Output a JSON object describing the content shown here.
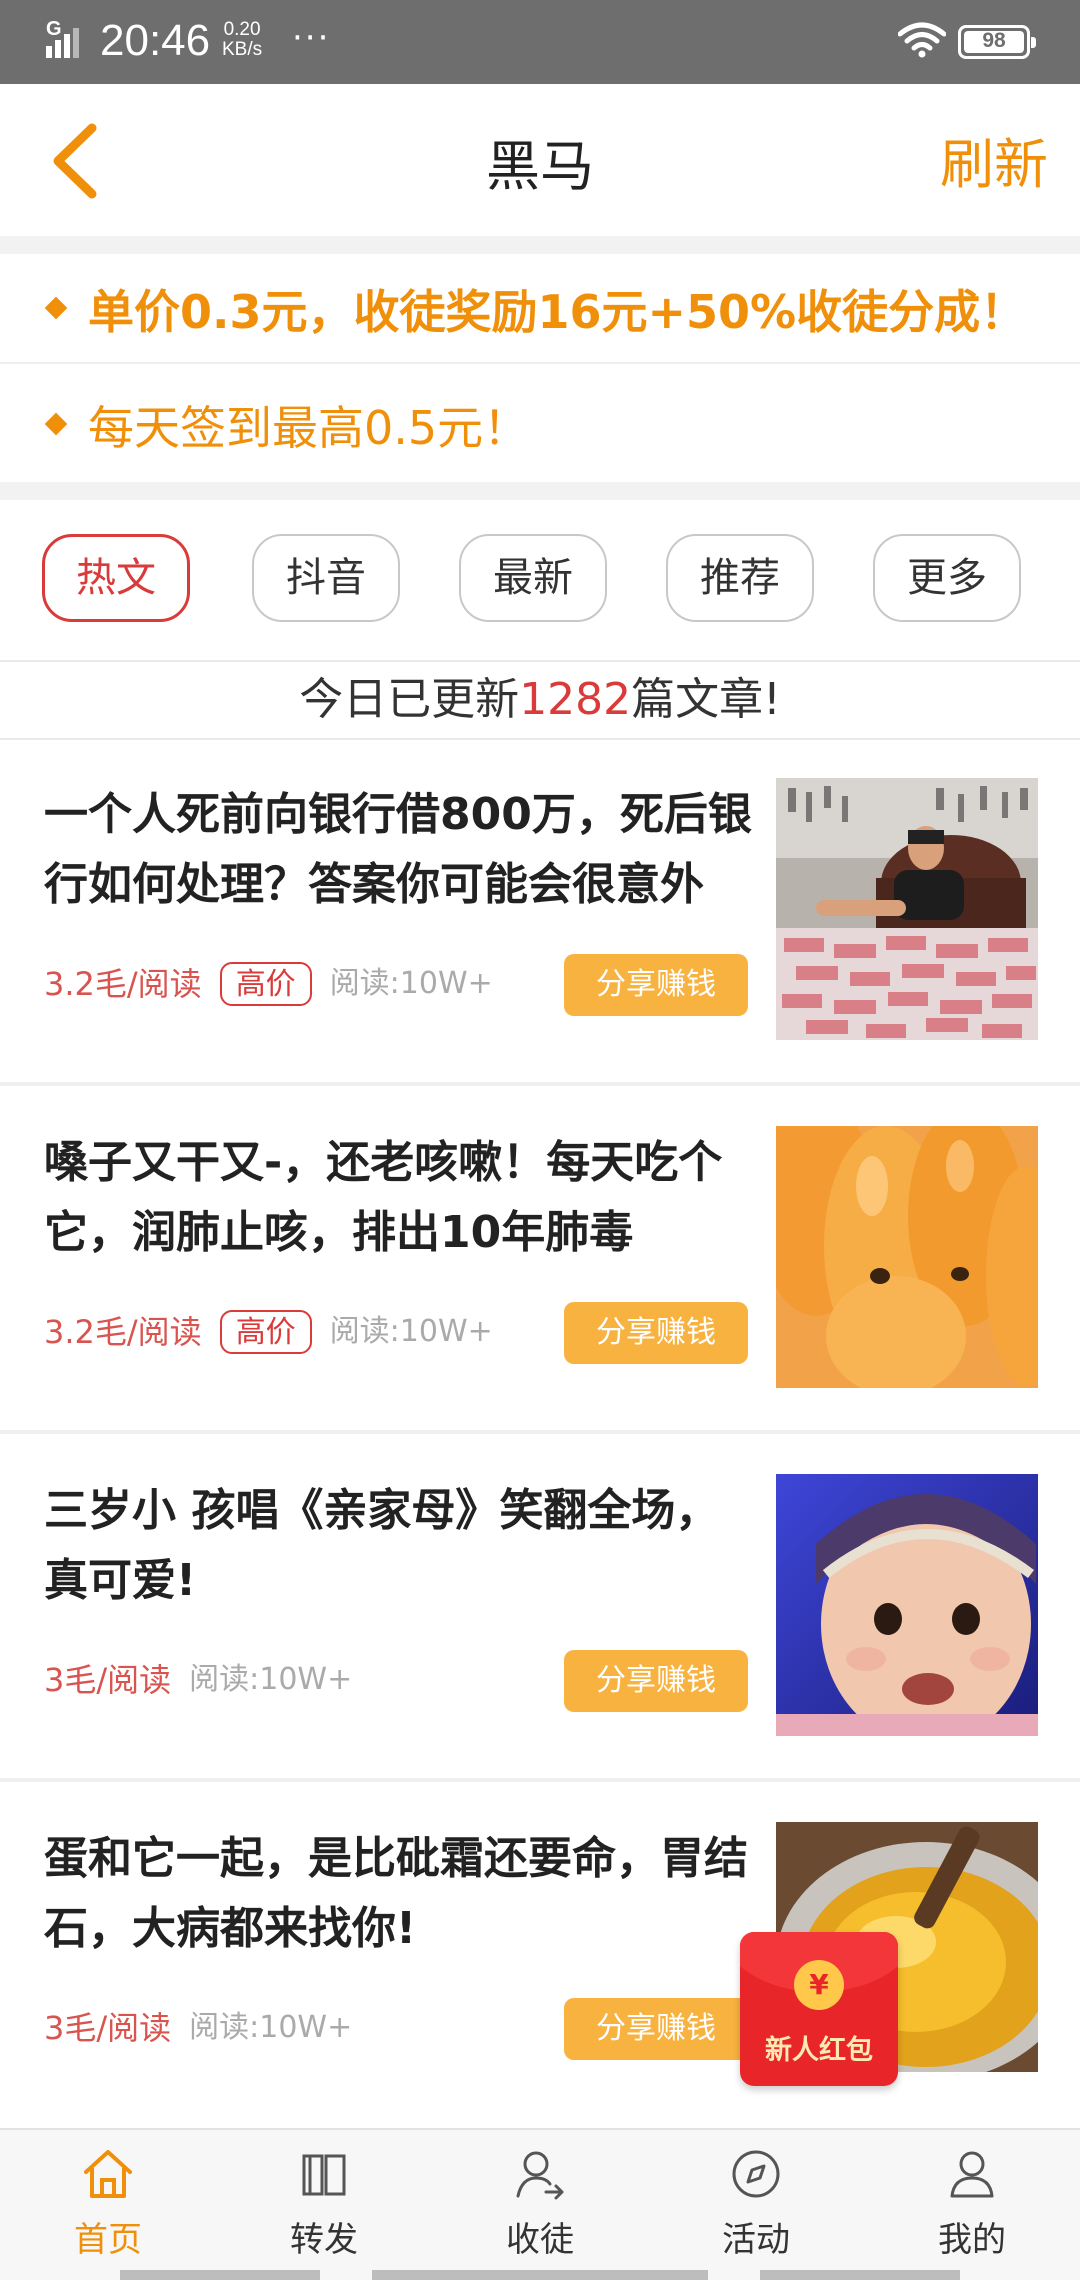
{
  "status_bar": {
    "network": "G",
    "time": "20:46",
    "speed_value": "0.20",
    "speed_unit": "KB/s",
    "dots": "···",
    "battery": "98"
  },
  "navbar": {
    "title": "黑马",
    "refresh_label": "刷新",
    "accent_color": "#f0900a"
  },
  "notices": [
    {
      "text": "单价0.3元，收徒奖励16元+50%收徒分成！"
    },
    {
      "text": "每天签到最高0.5元！"
    }
  ],
  "tabs": [
    {
      "label": "热文",
      "active": true
    },
    {
      "label": "抖音",
      "active": false
    },
    {
      "label": "最新",
      "active": false
    },
    {
      "label": "推荐",
      "active": false
    },
    {
      "label": "更多",
      "active": false
    }
  ],
  "update": {
    "prefix": "今日已更新",
    "count": "1282",
    "suffix": "篇文章!"
  },
  "articles": [
    {
      "title": "一个人死前向银行借800万，死后银行如何处理？答案你可能会很意外",
      "price": "3.2毛/阅读",
      "badge": "高价",
      "reads": "阅读:10W+",
      "share_label": "分享赚钱",
      "thumb_icon": "man-with-cash-photo"
    },
    {
      "title": "嗓子又干又-，还老咳嗽！每天吃个它，润肺止咳，排出10年肺毒",
      "price": "3.2毛/阅读",
      "badge": "高价",
      "reads": "阅读:10W+",
      "share_label": "分享赚钱",
      "thumb_icon": "loquat-fruit-photo"
    },
    {
      "title": "三岁小 孩唱《亲家母》笑翻全场，真可爱!",
      "price": "3毛/阅读",
      "reads": "阅读:10W+",
      "share_label": "分享赚钱",
      "thumb_icon": "child-singing-photo"
    },
    {
      "title": "蛋和它一起，是比砒霜还要命，胃结石，大病都来找你!",
      "price": "3毛/阅读",
      "reads": "阅读:10W+",
      "share_label": "分享赚钱",
      "thumb_icon": "egg-yolk-bowl-photo"
    }
  ],
  "red_packet": {
    "coin_symbol": "¥",
    "label": "新人红包"
  },
  "bottom_nav": [
    {
      "label": "首页",
      "icon": "home-icon",
      "active": true
    },
    {
      "label": "转发",
      "icon": "book-icon",
      "active": false
    },
    {
      "label": "收徒",
      "icon": "add-person-icon",
      "active": false
    },
    {
      "label": "活动",
      "icon": "compass-icon",
      "active": false
    },
    {
      "label": "我的",
      "icon": "person-icon",
      "active": false
    }
  ]
}
